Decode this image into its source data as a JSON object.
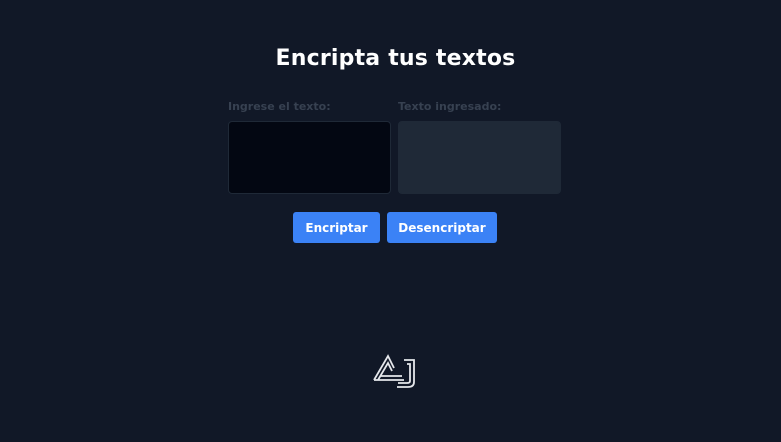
{
  "header": {
    "title": "Encripta tus textos"
  },
  "input": {
    "label": "Ingrese el texto:",
    "value": ""
  },
  "output": {
    "label": "Texto ingresado:",
    "value": ""
  },
  "actions": {
    "encrypt_label": "Encriptar",
    "decrypt_label": "Desencriptar"
  },
  "logo": {
    "icon": "aj-logo-icon",
    "text": "AJ"
  },
  "colors": {
    "background": "#111827",
    "accent": "#3b82f6",
    "input_bg": "#030712",
    "output_bg": "#1f2937",
    "label": "#374151"
  }
}
